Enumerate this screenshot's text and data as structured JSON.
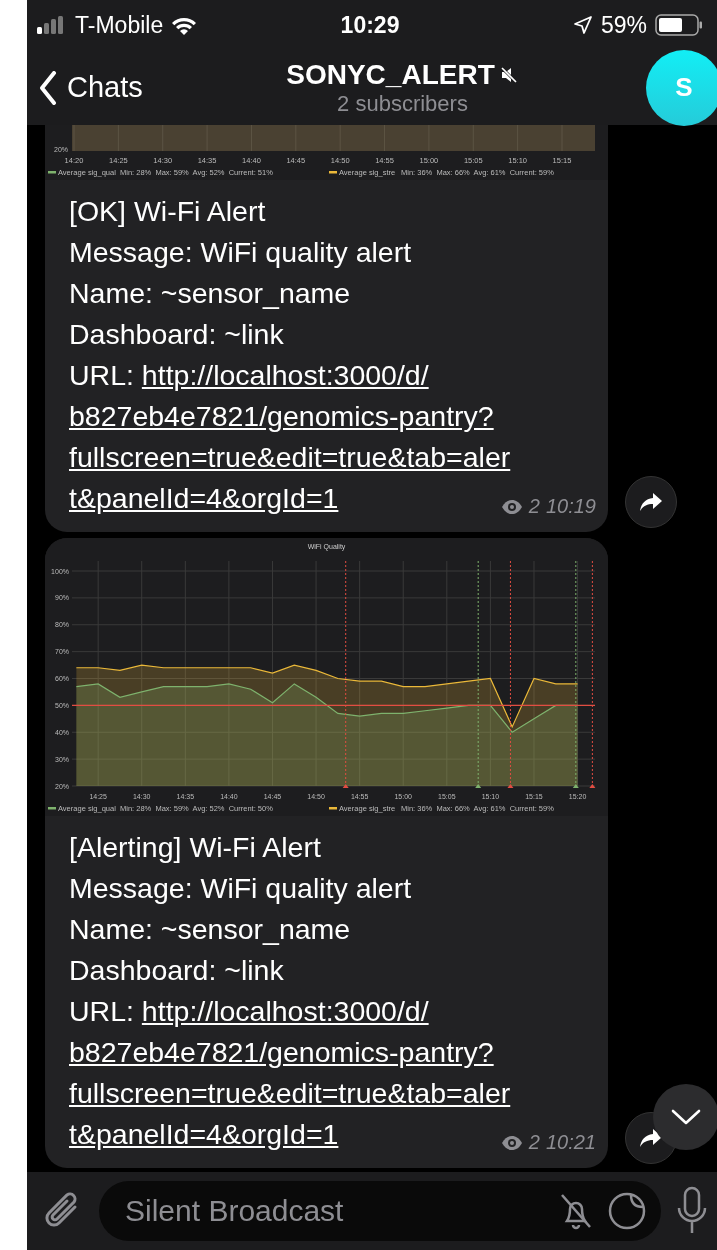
{
  "status_bar": {
    "carrier": "T-Mobile",
    "time": "10:29",
    "battery": "59%"
  },
  "header": {
    "back": "Chats",
    "title": "SONYC_ALERT",
    "muted": true,
    "subtitle": "2 subscribers",
    "avatar": "S"
  },
  "messages": [
    {
      "chart": {
        "kind": "fragment",
        "ytick": "20%",
        "xticks": [
          "14:20",
          "14:25",
          "14:30",
          "14:35",
          "14:40",
          "14:45",
          "14:50",
          "14:55",
          "15:00",
          "15:05",
          "15:10",
          "15:15"
        ],
        "legend": [
          {
            "name": "Average sig_qual",
            "stats": "Min: 28%  Max: 59%  Avg: 52%  Current: 51%",
            "color": "#7eb26d"
          },
          {
            "name": "Average sig_stre",
            "stats": "Min: 36%  Max: 66%  Avg: 61%  Current: 59%",
            "color": "#eab839"
          }
        ]
      },
      "lines": [
        "[OK] Wi-Fi Alert",
        "Message: WiFi quality alert",
        "Name: ~sensor_name",
        "Dashboard: ~link"
      ],
      "url_label": "URL:",
      "url_lines": [
        "http://localhost:3000/d/",
        "b827eb4e7821/genomics-pantry?",
        "fullscreen=true&edit=true&tab=aler",
        "t&panelId=4&orgId=1"
      ],
      "views": "2",
      "time": "10:19"
    },
    {
      "chart": {
        "kind": "full",
        "chart_data": {
          "type": "area",
          "title": "WiFi Quality",
          "grid": true,
          "legend": "bottom",
          "categories": [
            null,
            "14:25",
            null,
            "14:30",
            null,
            "14:35",
            null,
            "14:40",
            null,
            "14:45",
            null,
            "14:50",
            null,
            "14:55",
            null,
            "15:00",
            null,
            "15:05",
            null,
            "15:10",
            null,
            "15:15",
            null,
            "15:20"
          ],
          "series": [
            {
              "name": "Average sig_qual",
              "color": "#7eb26d",
              "values": [
                57,
                58,
                53,
                55,
                57,
                57,
                57,
                58,
                56,
                51,
                58,
                53,
                47,
                46,
                47,
                47,
                48,
                49,
                50,
                50,
                40,
                45,
                50,
                50
              ]
            },
            {
              "name": "Average sig_stre",
              "color": "#eab839",
              "values": [
                64,
                64,
                63,
                65,
                64,
                64,
                64,
                64,
                64,
                62,
                65,
                63,
                60,
                59,
                59,
                57,
                57,
                58,
                59,
                60,
                42,
                60,
                58,
                58
              ]
            }
          ],
          "ylim": [
            20,
            100
          ],
          "yticks": [
            {
              "value": 20,
              "label": "20%"
            },
            {
              "value": 30,
              "label": "30%"
            },
            {
              "value": 40,
              "label": "40%"
            },
            {
              "value": 50,
              "label": "50%"
            },
            {
              "value": 60,
              "label": "60%"
            },
            {
              "value": 70,
              "label": "70%"
            },
            {
              "value": 80,
              "label": "80%"
            },
            {
              "value": 90,
              "label": "90%"
            },
            {
              "value": 100,
              "label": "100%"
            }
          ],
          "ref_lines": [
            {
              "axis": "y",
              "value": 50,
              "color": "#e24d42"
            }
          ]
        },
        "legend": [
          {
            "stats": "Min: 28%  Max: 59%  Avg: 52%  Current: 50%"
          },
          {
            "stats": "Min: 36%  Max: 66%  Avg: 61%  Current: 59%"
          }
        ]
      },
      "lines": [
        "[Alerting] Wi-Fi Alert",
        "Message: WiFi quality alert",
        "Name: ~sensor_name",
        "Dashboard: ~link"
      ],
      "url_label": "URL:",
      "url_lines": [
        "http://localhost:3000/d/",
        "b827eb4e7821/genomics-pantry?",
        "fullscreen=true&edit=true&tab=aler",
        "t&panelId=4&orgId=1"
      ],
      "views": "2",
      "time": "10:21"
    }
  ],
  "input": {
    "placeholder": "Silent Broadcast"
  }
}
